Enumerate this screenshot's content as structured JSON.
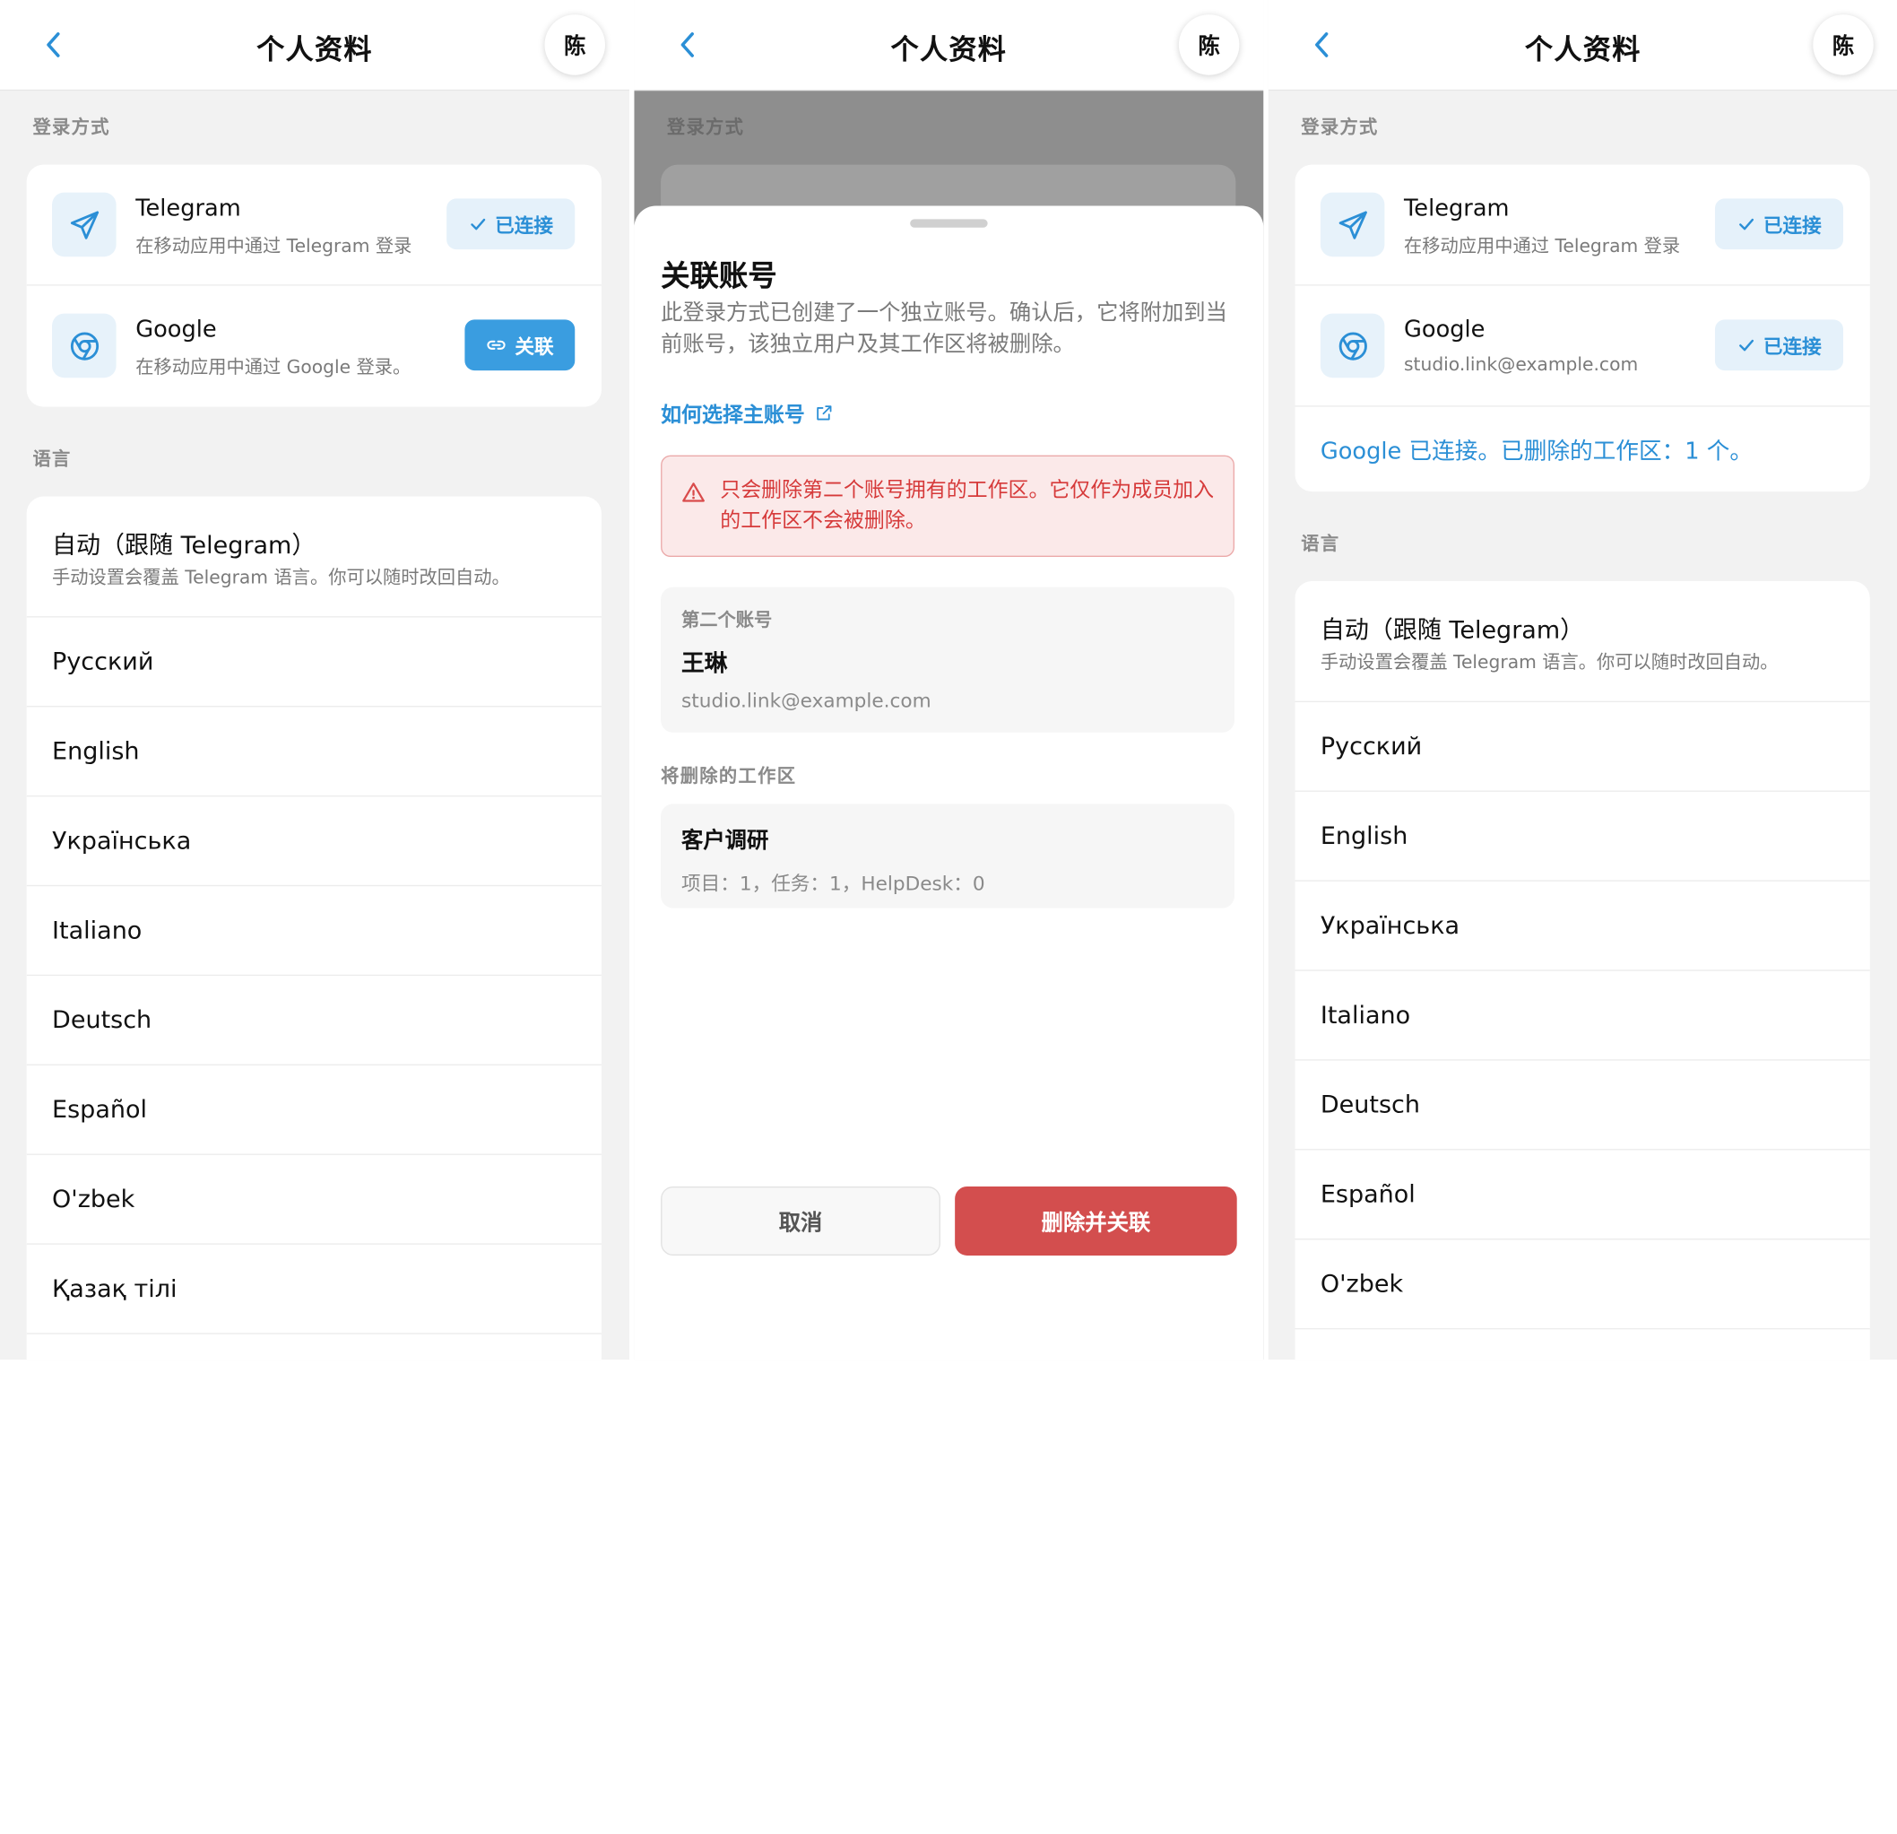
{
  "header": {
    "title": "个人资料",
    "avatar_initial": "陈"
  },
  "login_methods": {
    "section_label": "登录方式",
    "telegram": {
      "name": "Telegram",
      "description": "在移动应用中通过 Telegram 登录",
      "connected_label": "已连接"
    },
    "google": {
      "name": "Google",
      "description": "在移动应用中通过 Google 登录。",
      "link_label": "关联",
      "connected_label": "已连接",
      "email": "studio.link@example.com"
    },
    "connected_note": "Google 已连接。已删除的工作区：1 个。"
  },
  "language": {
    "section_label": "语言",
    "auto_title": "自动（跟随 Telegram）",
    "auto_subtitle": "手动设置会覆盖 Telegram 语言。你可以随时改回自动。",
    "options": [
      "Русский",
      "English",
      "Українська",
      "Italiano",
      "Deutsch",
      "Español",
      "O'zbek",
      "Қазақ тілі"
    ]
  },
  "dialog": {
    "title": "关联账号",
    "description": "此登录方式已创建了一个独立账号。确认后，它将附加到当前账号，该独立用户及其工作区将被删除。",
    "help_link": "如何选择主账号",
    "warning": "只会删除第二个账号拥有的工作区。它仅作为成员加入的工作区不会被删除。",
    "second_account_label": "第二个账号",
    "second_account_name": "王琳",
    "second_account_email": "studio.link@example.com",
    "workspaces_label": "将删除的工作区",
    "workspace_name": "客户调研",
    "workspace_stats": "项目：1，任务：1，HelpDesk：0",
    "cancel_label": "取消",
    "confirm_label": "删除并关联"
  },
  "colors": {
    "accent": "#2b8fd6",
    "danger": "#d34e4e",
    "warning_bg": "#fbe9e9",
    "background": "#f2f2f2"
  }
}
